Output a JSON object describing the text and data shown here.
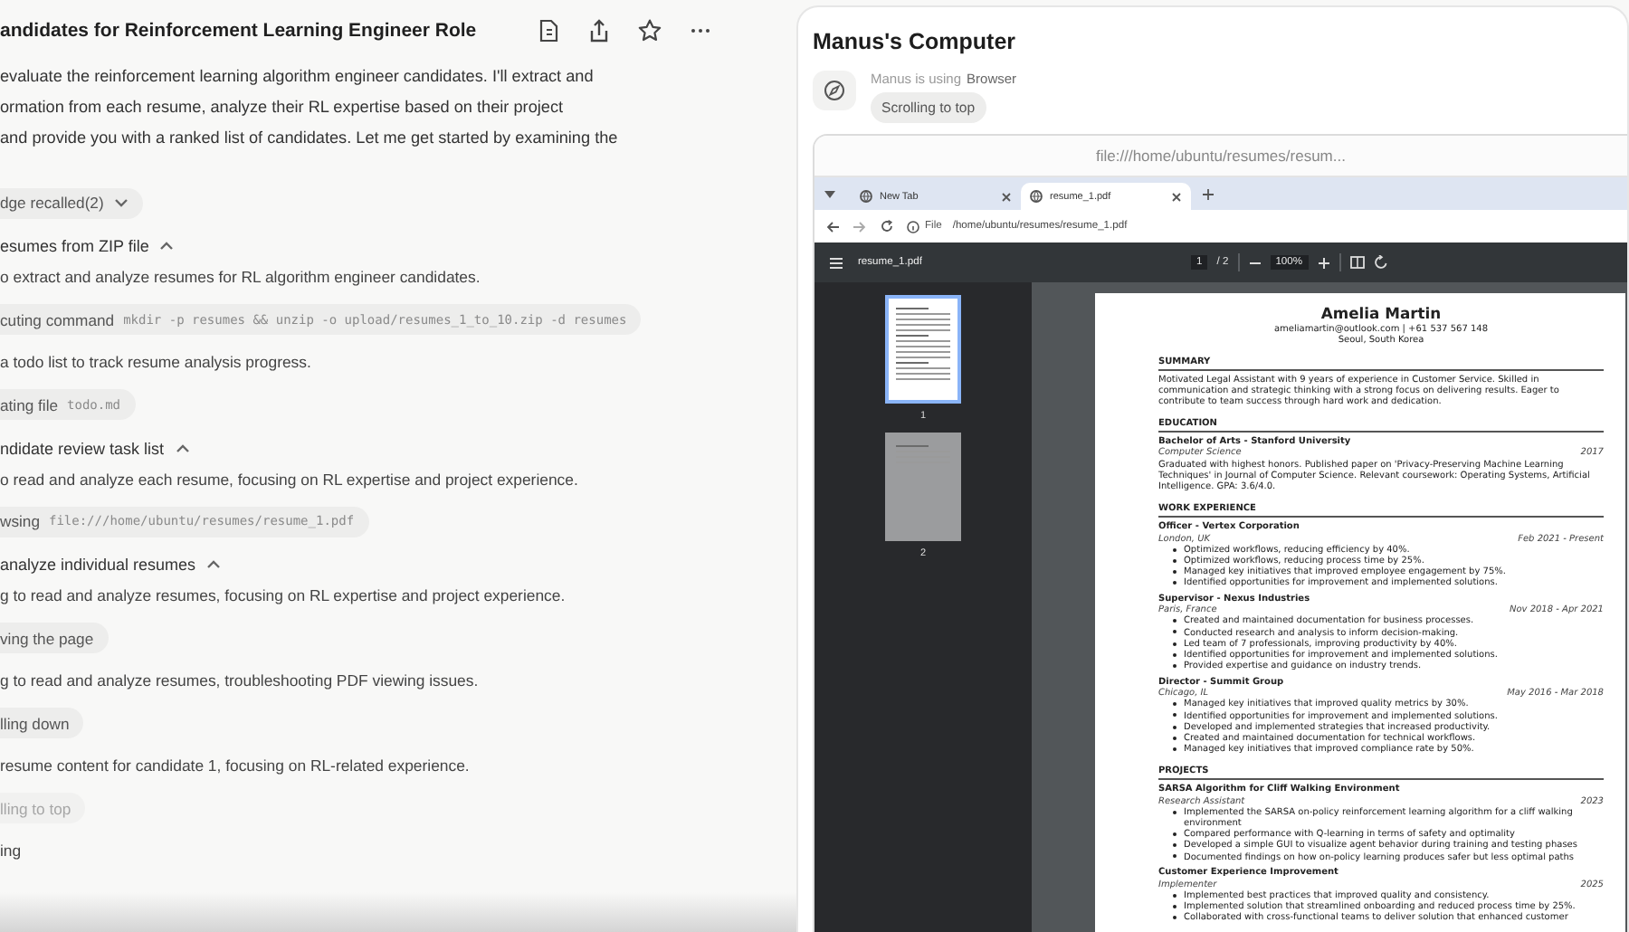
{
  "chat": {
    "title": "andidates for Reinforcement Learning Engineer Role",
    "intro": [
      "evaluate the reinforcement learning algorithm engineer candidates. I'll extract and",
      "ormation from each resume, analyze their RL expertise based on their project",
      "and provide you with a ranked list of candidates. Let me get started by examining the"
    ],
    "items": [
      {
        "kind": "recall",
        "label": "dge recalled(2)",
        "expanded": false
      },
      {
        "kind": "step",
        "label": "esumes from ZIP file",
        "expanded": true
      },
      {
        "kind": "note",
        "text": "o extract and analyze resumes for RL algorithm engineer candidates."
      },
      {
        "kind": "action",
        "label": "cuting command",
        "code": "mkdir -p resumes && unzip -o upload/resumes_1_to_10.zip -d resumes",
        "in_progress": false
      },
      {
        "kind": "note",
        "text": "a todo list to track resume analysis progress."
      },
      {
        "kind": "action",
        "label": "ating file",
        "code": "todo.md",
        "in_progress": false
      },
      {
        "kind": "step",
        "label": "ndidate review task list",
        "expanded": true
      },
      {
        "kind": "note",
        "text": "o read and analyze each resume, focusing on RL expertise and project experience."
      },
      {
        "kind": "action",
        "label": "wsing",
        "code": "file:///home/ubuntu/resumes/resume_1.pdf",
        "in_progress": false
      },
      {
        "kind": "step",
        "label": "analyze individual resumes",
        "expanded": true
      },
      {
        "kind": "note",
        "text": "g to read and analyze resumes, focusing on RL expertise and project experience."
      },
      {
        "kind": "action",
        "label": "ving the page",
        "in_progress": false
      },
      {
        "kind": "note",
        "text": "g to read and analyze resumes, troubleshooting PDF viewing issues."
      },
      {
        "kind": "action",
        "label": "lling down",
        "in_progress": false
      },
      {
        "kind": "note",
        "text": "resume content for candidate 1, focusing on RL-related experience."
      },
      {
        "kind": "action",
        "label": "lling to top",
        "in_progress": true
      },
      {
        "kind": "status",
        "text": "ing"
      }
    ]
  },
  "computer": {
    "title": "Manus's Computer",
    "status_prefix": "Manus is using",
    "tool": "Browser",
    "activity": "Scrolling to top",
    "browser": {
      "window_title": "file:///home/ubuntu/resumes/resum...",
      "tabs": [
        {
          "label": "New Tab",
          "selected": false
        },
        {
          "label": "resume_1.pdf",
          "selected": true
        }
      ],
      "address_scheme": "File",
      "address": "/home/ubuntu/resumes/resume_1.pdf",
      "pdf": {
        "filename": "resume_1.pdf",
        "page": "1",
        "page_total": "/ 2",
        "zoom": "100%",
        "thumbnails": [
          {
            "label": "1",
            "selected": true
          },
          {
            "label": "2",
            "selected": false
          }
        ],
        "resume": {
          "name": "Amelia Martin",
          "contact": "ameliamartin@outlook.com | +61 537 567 148",
          "location": "Seoul, South Korea",
          "sections": [
            {
              "heading": "SUMMARY",
              "text": "Motivated Legal Assistant with 9 years of experience in Customer Service. Skilled in communication and strategic thinking with a strong focus on delivering results. Eager to contribute to team success through hard work and dedication."
            },
            {
              "heading": "EDUCATION",
              "entries": [
                {
                  "title": "Bachelor of Arts - Stanford University",
                  "subtitle": "Computer Science",
                  "date": "2017",
                  "text": "Graduated with highest honors. Published paper on 'Privacy-Preserving Machine Learning Techniques' in Journal of Computer Science. Relevant coursework: Operating Systems, Artificial Intelligence. GPA: 3.6/4.0."
                }
              ]
            },
            {
              "heading": "WORK EXPERIENCE",
              "entries": [
                {
                  "title": "Officer - Vertex Corporation",
                  "subtitle": "London, UK",
                  "date": "Feb 2021 - Present",
                  "bullets": [
                    "Optimized workflows, reducing efficiency by 40%.",
                    "Optimized workflows, reducing process time by 25%.",
                    "Managed key initiatives that improved employee engagement by 75%.",
                    "Identified opportunities for improvement and implemented solutions."
                  ]
                },
                {
                  "title": "Supervisor - Nexus Industries",
                  "subtitle": "Paris, France",
                  "date": "Nov 2018 - Apr 2021",
                  "bullets": [
                    "Created and maintained documentation for business processes.",
                    "Conducted research and analysis to inform decision-making.",
                    "Led team of 7 professionals, improving productivity by 40%.",
                    "Identified opportunities for improvement and implemented solutions.",
                    "Provided expertise and guidance on industry trends."
                  ]
                },
                {
                  "title": "Director - Summit Group",
                  "subtitle": "Chicago, IL",
                  "date": "May 2016 - Mar 2018",
                  "bullets": [
                    "Managed key initiatives that improved quality metrics by 30%.",
                    "Identified opportunities for improvement and implemented solutions.",
                    "Developed and implemented strategies that increased productivity.",
                    "Created and maintained documentation for technical workflows.",
                    "Managed key initiatives that improved compliance rate by 50%."
                  ]
                }
              ]
            },
            {
              "heading": "PROJECTS",
              "entries": [
                {
                  "title": "SARSA Algorithm for Cliff Walking Environment",
                  "subtitle": "Research Assistant",
                  "date": "2023",
                  "bullets": [
                    "Implemented the SARSA on-policy reinforcement learning algorithm for a cliff walking environment",
                    "Compared performance with Q-learning in terms of safety and optimality",
                    "Developed a simple GUI to visualize agent behavior during training and testing phases",
                    "Documented findings on how on-policy learning produces safer but less optimal paths"
                  ]
                },
                {
                  "title": "Customer Experience Improvement",
                  "subtitle": "Implementer",
                  "date": "2025",
                  "bullets": [
                    "Implemented best practices that improved quality and consistency.",
                    "Implemented solution that streamlined onboarding and reduced process time by 25%.",
                    "Collaborated with cross-functional teams to deliver solution that enhanced customer"
                  ]
                }
              ]
            }
          ]
        }
      }
    }
  }
}
